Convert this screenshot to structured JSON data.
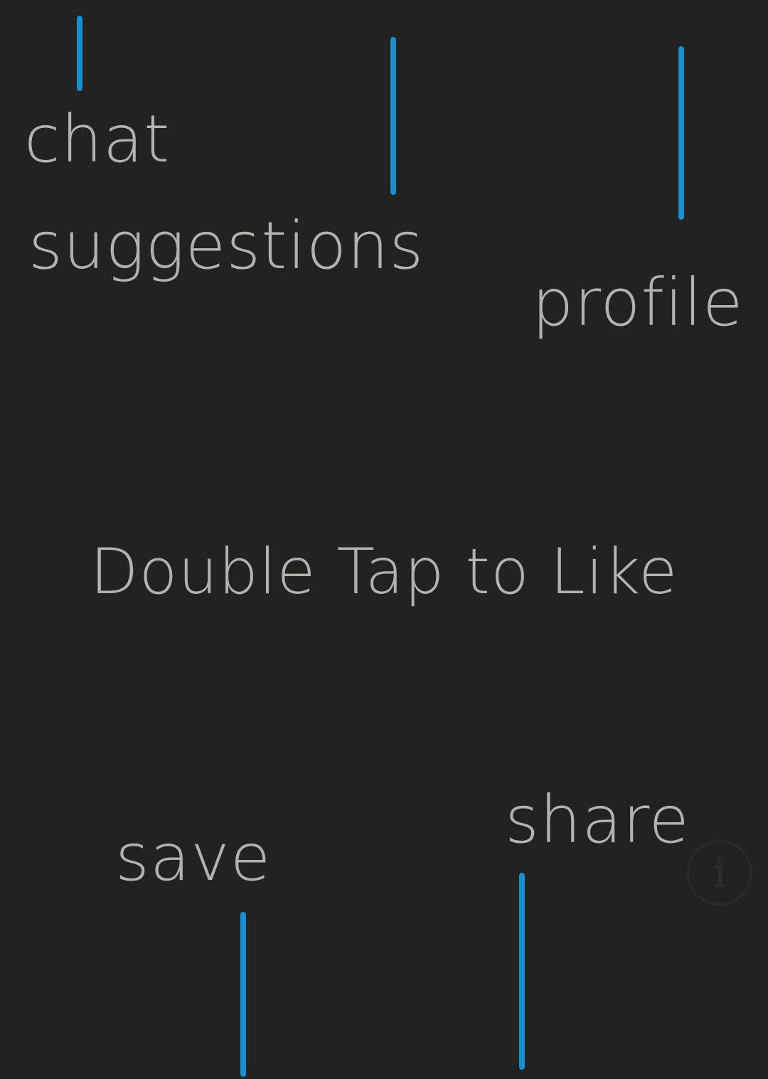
{
  "colors": {
    "background": "#222222",
    "accent_line": "#1a8fd0",
    "label_text": "#b3b3ad"
  },
  "overlay": {
    "chat_label": "chat",
    "suggestions_label": "suggestions",
    "profile_label": "profile",
    "center_hint": "Double Tap to Like",
    "save_label": "save",
    "share_label": "share",
    "info_icon": "info-icon",
    "info_glyph": "i"
  }
}
